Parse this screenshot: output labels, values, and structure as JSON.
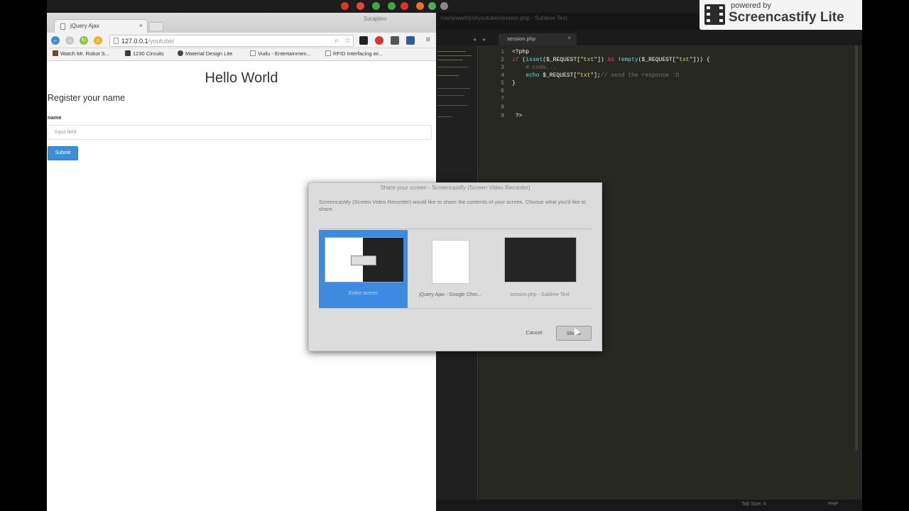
{
  "browser": {
    "tab_title": "jQuery Ajax",
    "tab_close": "×",
    "window_label": "Surajdeo",
    "url_host": "127.0.0.1",
    "url_path": "/youtube/",
    "menu_glyph": "≡",
    "bookmarks": [
      {
        "label": "Watch Mr. Robot S...",
        "color": "#6b4b2b"
      },
      {
        "label": "1230 Circuits",
        "color": "#3b3b3b"
      },
      {
        "label": "Material Design Lite",
        "color": "#444444"
      },
      {
        "label": "Vudu - Entertainmen...",
        "color": "#ffffff"
      },
      {
        "label": "RFID Interfacing wi...",
        "color": "#ffffff"
      }
    ]
  },
  "page": {
    "heading": "Hello World",
    "subtitle": "Register your name",
    "name_label": "name",
    "input_placeholder": "Input field",
    "submit_label": "Submit"
  },
  "editor": {
    "title": "/var/www/html/youtube/session.php - Sublime Text",
    "tab_label": "session.php",
    "tab_close": "×",
    "line_numbers": [
      "1",
      "2",
      "3",
      "4",
      "5",
      "6",
      "7",
      "8",
      "9"
    ],
    "status_spaces": "Tab Size: 4",
    "status_syntax": "PHP"
  },
  "dialog": {
    "title": "Share your screen - Screencastify (Screen Video Recorder)",
    "description": "Screencastify (Screen Video Recorder) would like to share the contents of your screen. Choose what you'd like to share.",
    "sources": [
      {
        "label": "Entire screen"
      },
      {
        "label": "jQuery Ajax - Google Chro..."
      },
      {
        "label": "session.php - Sublime Text"
      }
    ],
    "cancel_label": "Cancel",
    "share_label": "Share"
  },
  "badge": {
    "powered": "powered by",
    "brand": "Screencastify Lite"
  },
  "colors": {
    "accent_blue": "#3a8fd8",
    "selection_blue": "#3c8be0",
    "editor_bg": "#272822"
  },
  "icons": [
    "back-arrow-icon",
    "forward-arrow-icon",
    "reload-icon",
    "home-icon",
    "page-icon",
    "search-icon",
    "star-icon",
    "extension-icon",
    "chrome-menu-icon",
    "tab-favicon-icon",
    "film-icon"
  ]
}
